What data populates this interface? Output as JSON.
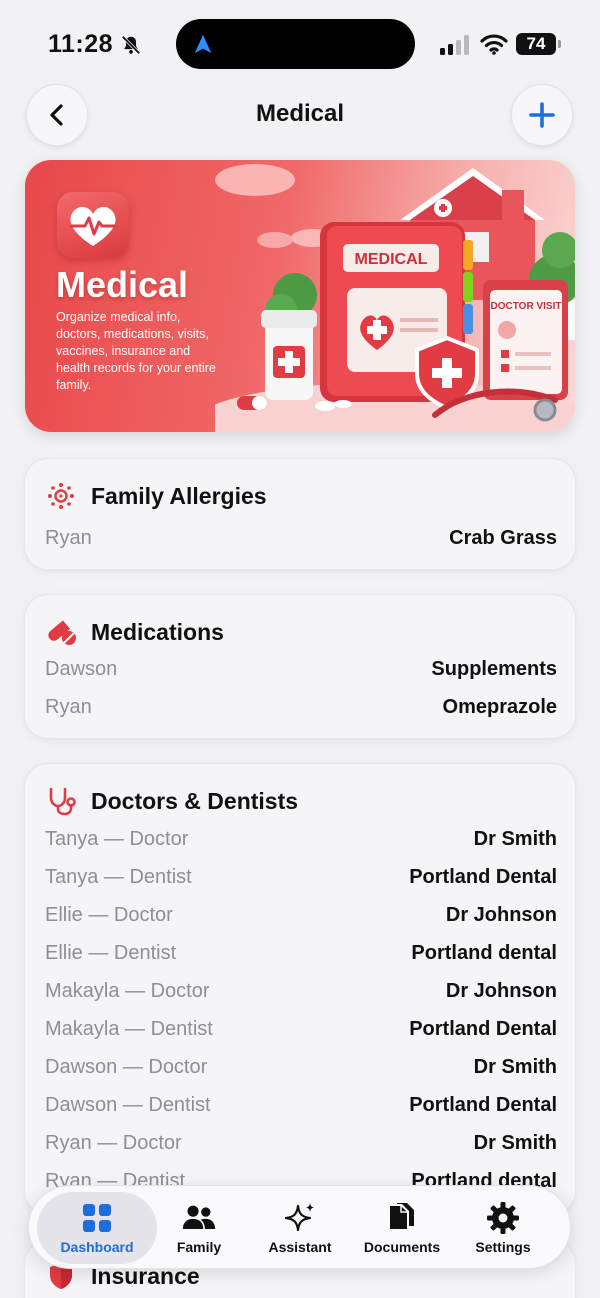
{
  "status_bar": {
    "time": "11:28",
    "battery": "74"
  },
  "header": {
    "title": "Medical"
  },
  "hero": {
    "title": "Medical",
    "description": "Organize medical info, doctors, medications, visits, vaccines, insurance and health records for your entire family.",
    "book_label": "MEDICAL",
    "clipboard_label": "DOCTOR VISIT"
  },
  "allergies": {
    "title": "Family Allergies",
    "rows": [
      {
        "label": "Ryan",
        "value": "Crab Grass"
      }
    ]
  },
  "medications": {
    "title": "Medications",
    "rows": [
      {
        "label": "Dawson",
        "value": "Supplements"
      },
      {
        "label": "Ryan",
        "value": "Omeprazole"
      }
    ]
  },
  "doctors": {
    "title": "Doctors & Dentists",
    "rows": [
      {
        "label": "Tanya — Doctor",
        "value": "Dr Smith"
      },
      {
        "label": "Tanya — Dentist",
        "value": "Portland Dental"
      },
      {
        "label": "Ellie — Doctor",
        "value": "Dr Johnson"
      },
      {
        "label": "Ellie — Dentist",
        "value": "Portland dental"
      },
      {
        "label": "Makayla — Doctor",
        "value": "Dr Johnson"
      },
      {
        "label": "Makayla — Dentist",
        "value": "Portland Dental"
      },
      {
        "label": "Dawson — Doctor",
        "value": "Dr Smith"
      },
      {
        "label": "Dawson — Dentist",
        "value": "Portland Dental"
      },
      {
        "label": "Ryan  — Doctor",
        "value": "Dr Smith"
      },
      {
        "label": "Ryan  — Dentist",
        "value": "Portland dental"
      }
    ]
  },
  "insurance": {
    "title": "Insurance"
  },
  "tabs": [
    {
      "label": "Dashboard",
      "icon": "grid-icon",
      "active": true
    },
    {
      "label": "Family",
      "icon": "people-icon",
      "active": false
    },
    {
      "label": "Assistant",
      "icon": "sparkles-icon",
      "active": false
    },
    {
      "label": "Documents",
      "icon": "documents-icon",
      "active": false
    },
    {
      "label": "Settings",
      "icon": "gear-icon",
      "active": false
    }
  ],
  "colors": {
    "accent": "#1e6fd9",
    "medical_red": "#e23b44",
    "secondary_text": "#8e8e93"
  }
}
